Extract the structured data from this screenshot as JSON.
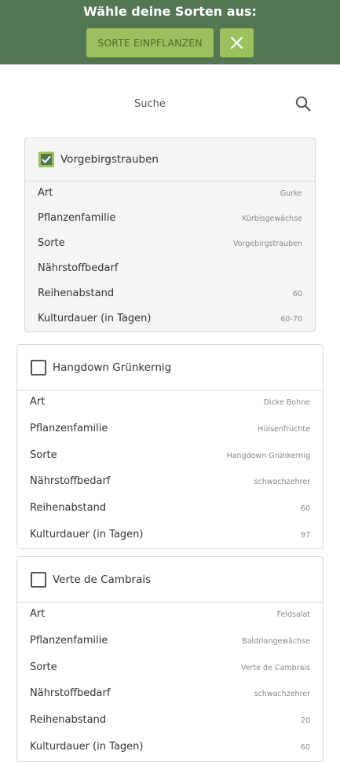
{
  "header": {
    "title": "Wähle deine Sorten aus:",
    "plant_button_label": "SORTE EINPFLANZEN",
    "close_icon": "close-icon"
  },
  "search": {
    "placeholder": "Suche",
    "icon": "search-icon"
  },
  "colors": {
    "header_bg": "#537753",
    "button_bg": "#9cc05e",
    "button_text": "#4d6b2e",
    "checkbox_checked": "#537753"
  },
  "varieties": [
    {
      "name": "Vorgebirgstrauben",
      "selected": true,
      "properties": [
        {
          "label": "Art",
          "value": "Gurke"
        },
        {
          "label": "Pflanzenfamilie",
          "value": "Kürbisgewächse"
        },
        {
          "label": "Sorte",
          "value": "Vorgebirgstrauben"
        },
        {
          "label": "Nährstoffbedarf",
          "value": ""
        },
        {
          "label": "Reihenabstand",
          "value": "60"
        },
        {
          "label": "Kulturdauer (in Tagen)",
          "value": "60-70"
        }
      ]
    },
    {
      "name": "Hangdown Grünkernig",
      "selected": false,
      "properties": [
        {
          "label": "Art",
          "value": "Dicke Bohne"
        },
        {
          "label": "Pflanzenfamilie",
          "value": "Hülsenfrüchte"
        },
        {
          "label": "Sorte",
          "value": "Hangdown Grünkernig"
        },
        {
          "label": "Nährstoffbedarf",
          "value": "schwachzehrer"
        },
        {
          "label": "Reihenabstand",
          "value": "60"
        },
        {
          "label": "Kulturdauer (in Tagen)",
          "value": "97"
        }
      ]
    },
    {
      "name": "Verte de Cambrais",
      "selected": false,
      "properties": [
        {
          "label": "Art",
          "value": "Feldsalat"
        },
        {
          "label": "Pflanzenfamilie",
          "value": "Baldriangewächse"
        },
        {
          "label": "Sorte",
          "value": "Verte de Cambrais"
        },
        {
          "label": "Nährstoffbedarf",
          "value": "schwachzehrer"
        },
        {
          "label": "Reihenabstand",
          "value": "20"
        },
        {
          "label": "Kulturdauer (in Tagen)",
          "value": "60"
        }
      ]
    }
  ]
}
